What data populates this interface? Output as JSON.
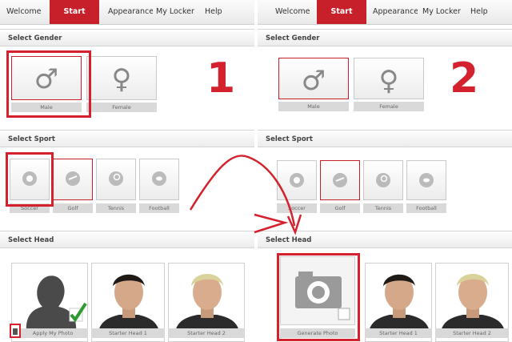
{
  "nav": {
    "tabs": [
      "Welcome",
      "Start",
      "Appearance",
      "My Locker",
      "Help"
    ],
    "active": "Start"
  },
  "sections": {
    "gender": "Select Gender",
    "sport": "Select Sport",
    "head": "Select Head"
  },
  "gender_options": [
    "Male",
    "Female"
  ],
  "sport_options": [
    "Soccer",
    "Golf",
    "Tennis",
    "Football"
  ],
  "left": {
    "step": "1",
    "heads": [
      "Apply My Photo",
      "Starter Head 1",
      "Starter Head 2"
    ]
  },
  "right": {
    "step": "2",
    "heads": [
      "Generate Photo",
      "Starter Head 1",
      "Starter Head 2"
    ]
  },
  "colors": {
    "accent": "#c8202a",
    "annotation": "#d3212d",
    "check": "#2f9a2f"
  }
}
